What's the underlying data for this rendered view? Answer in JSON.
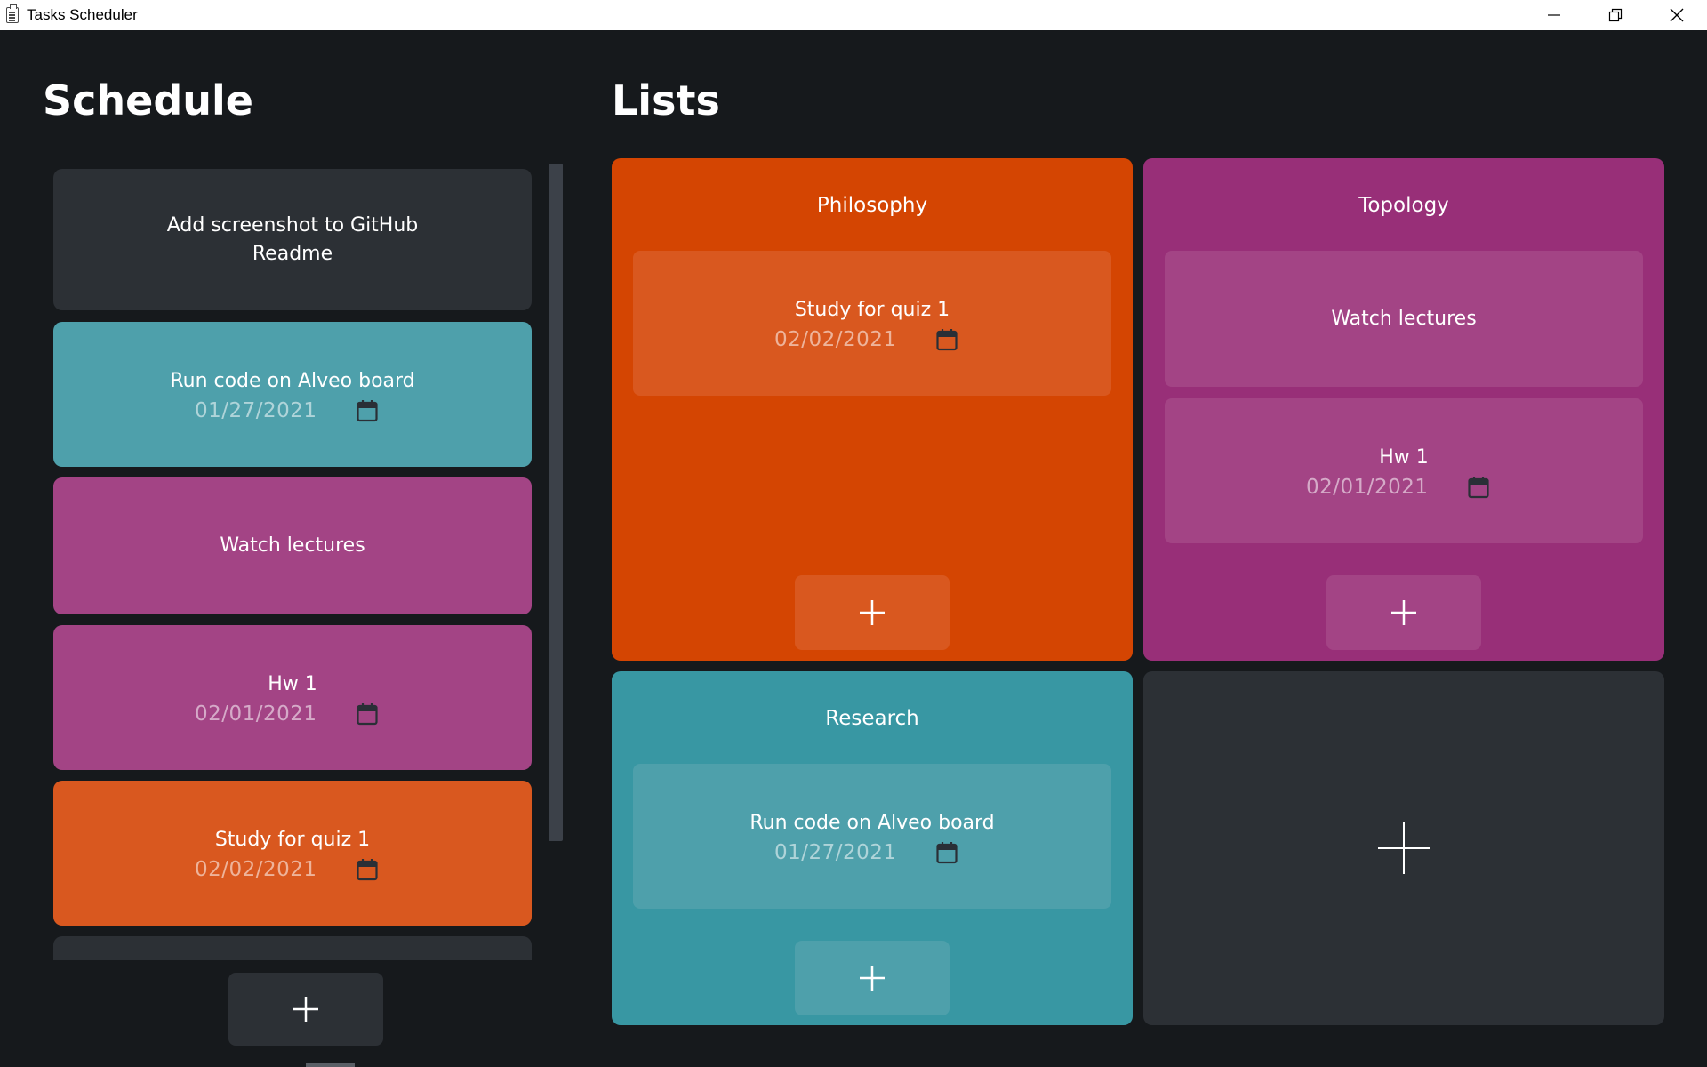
{
  "window": {
    "title": "Tasks Scheduler"
  },
  "headings": {
    "schedule": "Schedule",
    "lists": "Lists"
  },
  "schedule": {
    "items": [
      {
        "title": "Add screenshot to GitHub\nReadme",
        "date": ""
      },
      {
        "title": "Run code on Alveo board",
        "date": "01/27/2021"
      },
      {
        "title": "Watch lectures",
        "date": ""
      },
      {
        "title": "Hw 1",
        "date": "02/01/2021"
      },
      {
        "title": "Study for quiz 1",
        "date": "02/02/2021"
      }
    ]
  },
  "lists": [
    {
      "name": "Philosophy",
      "items": [
        {
          "title": "Study for quiz 1",
          "date": "02/02/2021"
        }
      ]
    },
    {
      "name": "Topology",
      "items": [
        {
          "title": "Watch lectures",
          "date": ""
        },
        {
          "title": "Hw 1",
          "date": "02/01/2021"
        }
      ]
    },
    {
      "name": "Research",
      "items": [
        {
          "title": "Run code on Alveo board",
          "date": "01/27/2021"
        }
      ]
    }
  ],
  "colors": {
    "background": "#16191c",
    "neutral_card": "#2c3035",
    "teal_card": "#4ea0ab",
    "teal_panel": "#3897a3",
    "magenta_card": "#a34485",
    "magenta_panel": "#982f78",
    "orange_card": "#d9581f",
    "orange_panel": "#d44502",
    "scrollbar": "#3c4149"
  },
  "icons": {
    "calendar": "calendar-icon",
    "add": "plus-icon",
    "minimize": "minimize-icon",
    "restore": "restore-icon",
    "close": "close-icon"
  }
}
